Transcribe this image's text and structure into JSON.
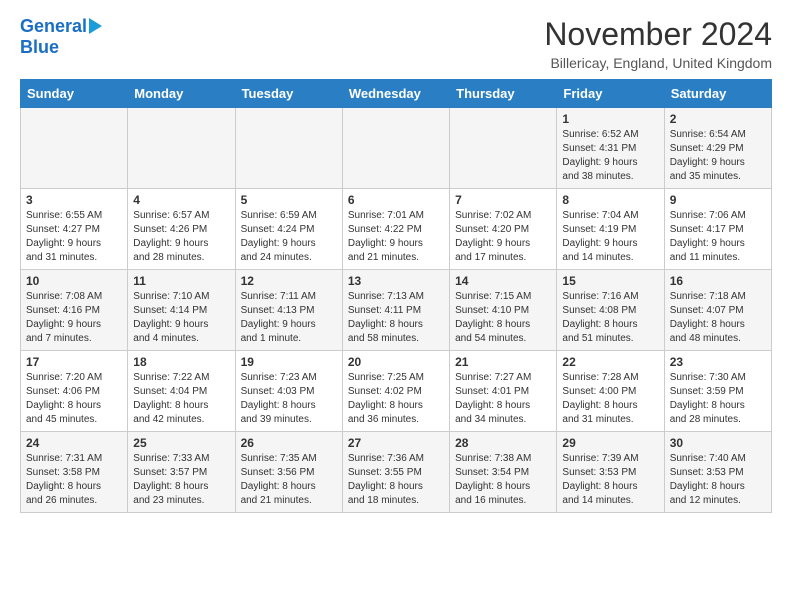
{
  "logo": {
    "line1": "General",
    "line2": "Blue"
  },
  "title": "November 2024",
  "location": "Billericay, England, United Kingdom",
  "weekdays": [
    "Sunday",
    "Monday",
    "Tuesday",
    "Wednesday",
    "Thursday",
    "Friday",
    "Saturday"
  ],
  "weeks": [
    [
      {
        "day": "",
        "info": ""
      },
      {
        "day": "",
        "info": ""
      },
      {
        "day": "",
        "info": ""
      },
      {
        "day": "",
        "info": ""
      },
      {
        "day": "",
        "info": ""
      },
      {
        "day": "1",
        "info": "Sunrise: 6:52 AM\nSunset: 4:31 PM\nDaylight: 9 hours\nand 38 minutes."
      },
      {
        "day": "2",
        "info": "Sunrise: 6:54 AM\nSunset: 4:29 PM\nDaylight: 9 hours\nand 35 minutes."
      }
    ],
    [
      {
        "day": "3",
        "info": "Sunrise: 6:55 AM\nSunset: 4:27 PM\nDaylight: 9 hours\nand 31 minutes."
      },
      {
        "day": "4",
        "info": "Sunrise: 6:57 AM\nSunset: 4:26 PM\nDaylight: 9 hours\nand 28 minutes."
      },
      {
        "day": "5",
        "info": "Sunrise: 6:59 AM\nSunset: 4:24 PM\nDaylight: 9 hours\nand 24 minutes."
      },
      {
        "day": "6",
        "info": "Sunrise: 7:01 AM\nSunset: 4:22 PM\nDaylight: 9 hours\nand 21 minutes."
      },
      {
        "day": "7",
        "info": "Sunrise: 7:02 AM\nSunset: 4:20 PM\nDaylight: 9 hours\nand 17 minutes."
      },
      {
        "day": "8",
        "info": "Sunrise: 7:04 AM\nSunset: 4:19 PM\nDaylight: 9 hours\nand 14 minutes."
      },
      {
        "day": "9",
        "info": "Sunrise: 7:06 AM\nSunset: 4:17 PM\nDaylight: 9 hours\nand 11 minutes."
      }
    ],
    [
      {
        "day": "10",
        "info": "Sunrise: 7:08 AM\nSunset: 4:16 PM\nDaylight: 9 hours\nand 7 minutes."
      },
      {
        "day": "11",
        "info": "Sunrise: 7:10 AM\nSunset: 4:14 PM\nDaylight: 9 hours\nand 4 minutes."
      },
      {
        "day": "12",
        "info": "Sunrise: 7:11 AM\nSunset: 4:13 PM\nDaylight: 9 hours\nand 1 minute."
      },
      {
        "day": "13",
        "info": "Sunrise: 7:13 AM\nSunset: 4:11 PM\nDaylight: 8 hours\nand 58 minutes."
      },
      {
        "day": "14",
        "info": "Sunrise: 7:15 AM\nSunset: 4:10 PM\nDaylight: 8 hours\nand 54 minutes."
      },
      {
        "day": "15",
        "info": "Sunrise: 7:16 AM\nSunset: 4:08 PM\nDaylight: 8 hours\nand 51 minutes."
      },
      {
        "day": "16",
        "info": "Sunrise: 7:18 AM\nSunset: 4:07 PM\nDaylight: 8 hours\nand 48 minutes."
      }
    ],
    [
      {
        "day": "17",
        "info": "Sunrise: 7:20 AM\nSunset: 4:06 PM\nDaylight: 8 hours\nand 45 minutes."
      },
      {
        "day": "18",
        "info": "Sunrise: 7:22 AM\nSunset: 4:04 PM\nDaylight: 8 hours\nand 42 minutes."
      },
      {
        "day": "19",
        "info": "Sunrise: 7:23 AM\nSunset: 4:03 PM\nDaylight: 8 hours\nand 39 minutes."
      },
      {
        "day": "20",
        "info": "Sunrise: 7:25 AM\nSunset: 4:02 PM\nDaylight: 8 hours\nand 36 minutes."
      },
      {
        "day": "21",
        "info": "Sunrise: 7:27 AM\nSunset: 4:01 PM\nDaylight: 8 hours\nand 34 minutes."
      },
      {
        "day": "22",
        "info": "Sunrise: 7:28 AM\nSunset: 4:00 PM\nDaylight: 8 hours\nand 31 minutes."
      },
      {
        "day": "23",
        "info": "Sunrise: 7:30 AM\nSunset: 3:59 PM\nDaylight: 8 hours\nand 28 minutes."
      }
    ],
    [
      {
        "day": "24",
        "info": "Sunrise: 7:31 AM\nSunset: 3:58 PM\nDaylight: 8 hours\nand 26 minutes."
      },
      {
        "day": "25",
        "info": "Sunrise: 7:33 AM\nSunset: 3:57 PM\nDaylight: 8 hours\nand 23 minutes."
      },
      {
        "day": "26",
        "info": "Sunrise: 7:35 AM\nSunset: 3:56 PM\nDaylight: 8 hours\nand 21 minutes."
      },
      {
        "day": "27",
        "info": "Sunrise: 7:36 AM\nSunset: 3:55 PM\nDaylight: 8 hours\nand 18 minutes."
      },
      {
        "day": "28",
        "info": "Sunrise: 7:38 AM\nSunset: 3:54 PM\nDaylight: 8 hours\nand 16 minutes."
      },
      {
        "day": "29",
        "info": "Sunrise: 7:39 AM\nSunset: 3:53 PM\nDaylight: 8 hours\nand 14 minutes."
      },
      {
        "day": "30",
        "info": "Sunrise: 7:40 AM\nSunset: 3:53 PM\nDaylight: 8 hours\nand 12 minutes."
      }
    ]
  ]
}
